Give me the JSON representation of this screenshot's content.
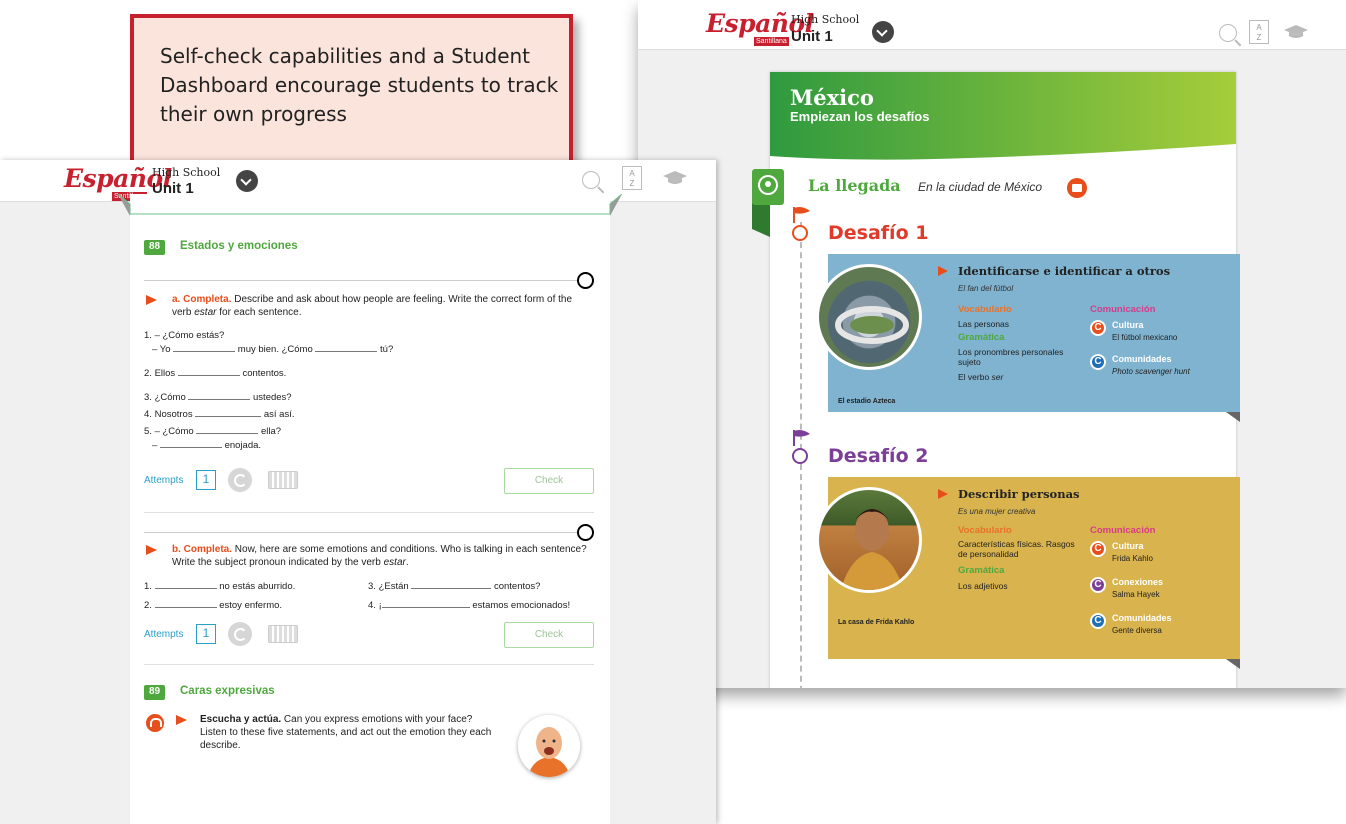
{
  "callout": {
    "text": "Self-check capabilities and a Student Dashboard encourage students to track their own progress"
  },
  "app": {
    "logo": "Español",
    "logo_sub": "Santillana",
    "level": "High School",
    "unit": "Unit 1",
    "icons": [
      "chevron-down-icon",
      "search-icon",
      "glossary-az-icon",
      "graduation-cap-icon"
    ]
  },
  "colors": {
    "brand_red": "#c8202f",
    "green": "#4fa83d",
    "orange": "#e84e1b",
    "purple": "#7b3f98",
    "blue_card": "#7fb3d0",
    "gold_card": "#d8b34e",
    "attempts_blue": "#2aa0c8"
  },
  "left_page": {
    "section88": {
      "number": "88",
      "title": "Estados y emociones",
      "exercise_a": {
        "label": "a. Completa.",
        "instructions_part1": " Describe and ask about how people are feeling. Write the correct form of the verb ",
        "verb": "estar",
        "instructions_part2": " for each sentence.",
        "items": [
          {
            "n": "1.",
            "text1": "– ¿Cómo estás?"
          },
          {
            "text1": "– Yo",
            "text2": "muy bien. ¿Cómo",
            "text3": "tú?"
          },
          {
            "n": "2.",
            "text1": "Ellos",
            "text2": "contentos."
          },
          {
            "n": "3.",
            "text1": "¿Cómo",
            "text2": "ustedes?"
          },
          {
            "n": "4.",
            "text1": "Nosotros",
            "text2": "así así."
          },
          {
            "n": "5.",
            "text1": "– ¿Cómo",
            "text2": "ella?"
          },
          {
            "text1": "–",
            "text2": "enojada."
          }
        ],
        "attempts_label": "Attempts",
        "attempts_value": "1",
        "check_label": "Check"
      },
      "exercise_b": {
        "label": "b. Completa.",
        "instructions_part1": " Now, here are some emotions and conditions. Who is talking in each sentence? Write the subject pronoun indicated by the verb ",
        "verb": "estar",
        "instructions_part2": ".",
        "items": [
          {
            "n": "1.",
            "text": "no estás aburrido."
          },
          {
            "n": "3.",
            "pre": "¿Están",
            "text": "contentos?"
          },
          {
            "n": "2.",
            "text": "estoy enfermo."
          },
          {
            "n": "4.",
            "pre": "¡",
            "text": "estamos emocionados!"
          }
        ],
        "attempts_label": "Attempts",
        "attempts_value": "1",
        "check_label": "Check"
      }
    },
    "section89": {
      "number": "89",
      "title": "Caras expresivas",
      "label": "Escucha y actúa.",
      "text": " Can you express emotions with your face? Listen to these five statements, and act out the emotion they each describe."
    }
  },
  "right_page": {
    "header_title": "México",
    "header_sub": "Empiezan los desafíos",
    "arrival": "La llegada",
    "arrival_sub": "En la ciudad de México",
    "desafio1": {
      "title": "Desafío 1",
      "photo_caption": "El estadio Azteca",
      "topic": "Identificarse e identificar a otros",
      "video": "El fan del fútbol",
      "vocab_head": "Vocabulario",
      "vocab": "Las personas",
      "gram_head": "Gramática",
      "gram1": "Los pronombres personales sujeto",
      "gram2_pre": "El verbo ",
      "gram2_it": "ser",
      "com_head": "Comunicación",
      "c1_title": "Cultura",
      "c1_text": "El fútbol mexicano",
      "c2_title": "Comunidades",
      "c2_text": "Photo scavenger hunt"
    },
    "desafio2": {
      "title": "Desafío 2",
      "photo_caption": "La casa de Frida Kahlo",
      "topic": "Describir personas",
      "video": "Es una mujer creativa",
      "vocab_head": "Vocabulario",
      "vocab": "Características físicas. Rasgos de personalidad",
      "gram_head": "Gramática",
      "gram1": "Los adjetivos",
      "com_head": "Comunicación",
      "c1_title": "Cultura",
      "c1_text": "Frida Kahlo",
      "c2_title": "Conexiones",
      "c2_text": "Salma Hayek",
      "c3_title": "Comunidades",
      "c3_text": "Gente diversa"
    },
    "badge_letter": "C"
  }
}
